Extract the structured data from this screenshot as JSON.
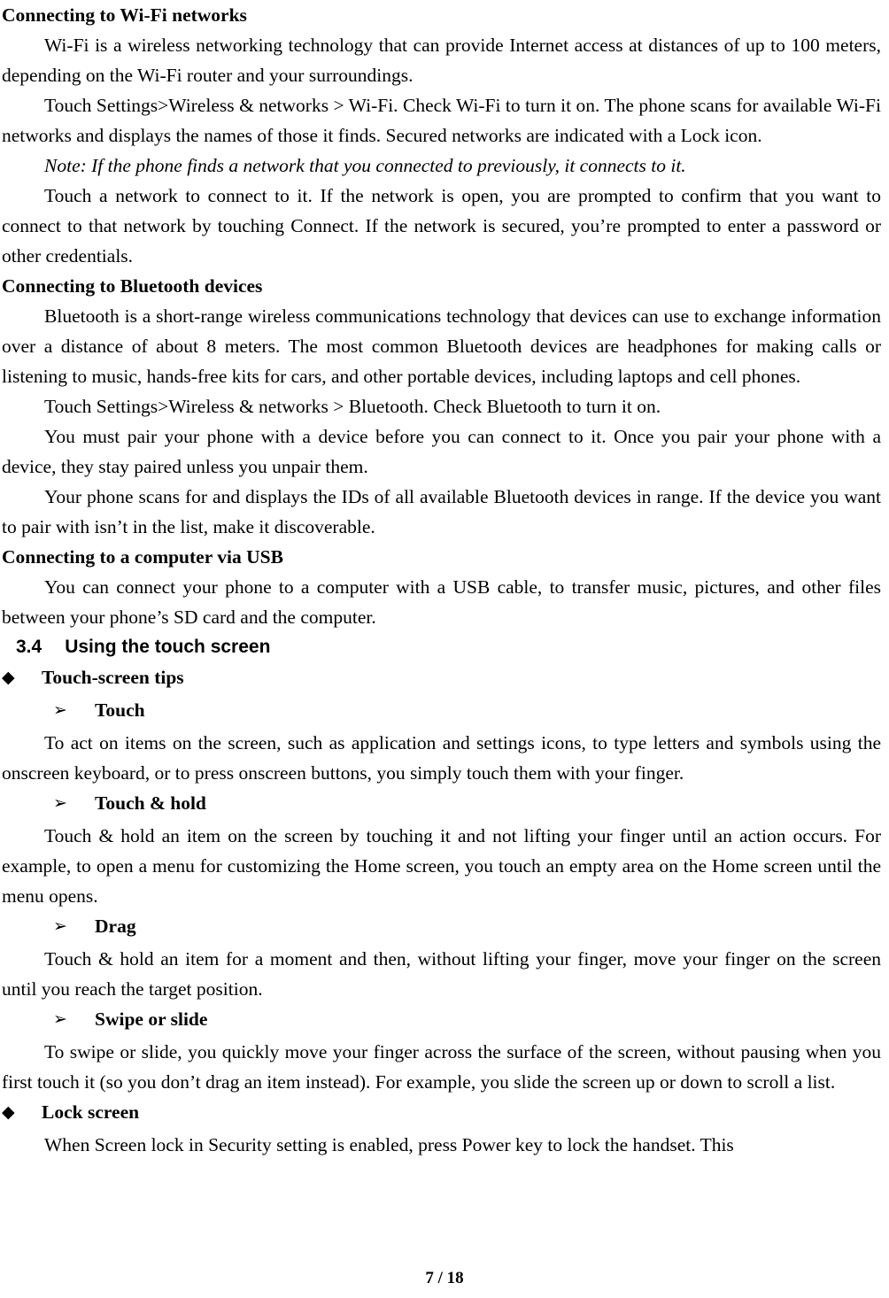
{
  "document": {
    "page_label": "7 / 18",
    "page_number": 7,
    "total_pages": 18
  },
  "bullets": {
    "diamond": "◆",
    "arrow": "➢"
  },
  "sections": [
    {
      "id": "wifi",
      "heading": "Connecting to Wi-Fi networks",
      "paragraphs": [
        "Wi-Fi is a wireless networking technology that can provide Internet access at distances of up to 100 meters, depending on the Wi-Fi router and your surroundings.",
        "Touch Settings>Wireless & networks > Wi-Fi. Check Wi-Fi to turn it on. The phone scans for available Wi-Fi networks and displays the names of those it finds. Secured networks are indicated with a Lock icon."
      ],
      "note": "Note: If the phone finds a network that you connected to previously, it connects to it.",
      "paragraphs_after_note": [
        "Touch a network to connect to it. If the network is open, you are prompted to confirm that you want to connect to that network by touching Connect. If the network is secured, you’re prompted to enter a password or other credentials."
      ]
    },
    {
      "id": "bluetooth",
      "heading": "Connecting to Bluetooth devices",
      "paragraphs": [
        "Bluetooth is a short-range wireless communications technology that devices can use to exchange information over a distance of about 8 meters. The most common Bluetooth devices are headphones for making calls or listening to music, hands-free kits for cars, and other portable devices, including laptops and cell phones.",
        "Touch Settings>Wireless & networks > Bluetooth. Check Bluetooth to turn it on.",
        "You must pair your phone with a device before you can connect to it. Once you pair your phone with a device, they stay paired unless you unpair them.",
        "Your phone scans for and displays the IDs of all available Bluetooth devices in range. If the device you want to pair with isn’t in the list, make it discoverable."
      ]
    },
    {
      "id": "usb",
      "heading": "Connecting to a computer via USB",
      "paragraphs": [
        "You can connect your phone to a computer with a USB cable, to transfer music, pictures, and other files between your phone’s SD card and the computer."
      ]
    }
  ],
  "numbered_section": {
    "number": "3.4",
    "title": "Using the touch screen"
  },
  "touch_tips": {
    "heading": "Touch-screen tips",
    "items": [
      {
        "label": "Touch",
        "body": "To act on items on the screen, such as application and settings icons, to type letters and symbols using the onscreen keyboard, or to press onscreen buttons, you simply touch them with your finger."
      },
      {
        "label": "Touch & hold",
        "body": "Touch & hold an item on the screen by touching it and not lifting your finger until an action occurs. For example, to open a menu for customizing the Home screen, you touch an empty area on the Home screen until the menu opens."
      },
      {
        "label": "Drag",
        "body": "Touch & hold an item for a moment and then, without lifting your finger, move your finger on the screen until you reach the target position."
      },
      {
        "label": "Swipe or slide",
        "body": "To swipe or slide, you quickly move your finger across the surface of the screen, without pausing when you first touch it (so you don’t drag an item instead). For example, you slide the screen up or down to scroll a list."
      }
    ]
  },
  "lock_screen": {
    "heading": "Lock screen",
    "body": "When Screen lock in Security setting is enabled, press Power key to lock the handset. This"
  }
}
